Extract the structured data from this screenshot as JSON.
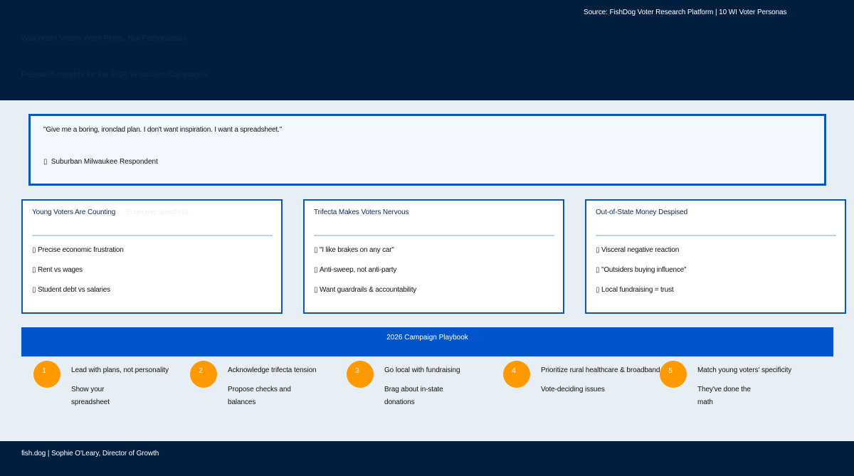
{
  "header": {
    "source": "Source: FishDog Voter Research Platform | 10 WI Voter Personas",
    "title": "Wisconsin Voters Want Plans, Not Personalities",
    "subtitle": "Research Insights for the 2026 Wisconsin Campaigns"
  },
  "quote": {
    "text": "\"Give me a boring, ironclad plan. I don't want inspiration. I want a spreadsheet.\"",
    "attribution_icon": "person-icon",
    "attribution": "Suburban Milwaukee Respondent"
  },
  "cards": [
    {
      "title": "Young Voters Are Counting",
      "subtitle": "Economic specificity",
      "items": [
        "Precise economic frustration",
        "Rent vs wages",
        "Student debt vs salaries"
      ]
    },
    {
      "title": "Trifecta Makes Voters Nervous",
      "items": [
        "\"I like brakes on any car\"",
        "Anti-sweep, not anti-party",
        "Want guardrails & accountability"
      ]
    },
    {
      "title": "Out-of-State Money Despised",
      "items": [
        "Visceral negative reaction",
        "\"Outsiders buying influence\"",
        "Local fundraising = trust"
      ]
    }
  ],
  "playbook": {
    "title": "2026 Campaign Playbook",
    "steps": [
      {
        "num": "1",
        "title": "Lead with plans, not personality",
        "desc": "Show your spreadsheet"
      },
      {
        "num": "2",
        "title": "Acknowledge trifecta tension",
        "desc": "Propose checks and balances"
      },
      {
        "num": "3",
        "title": "Go local with fundraising",
        "desc": "Brag about in-state donations"
      },
      {
        "num": "4",
        "title": "Prioritize rural healthcare & broadband",
        "desc": "Vote-deciding issues"
      },
      {
        "num": "5",
        "title": "Match young voters' specificity",
        "desc": "They've done the math"
      }
    ]
  },
  "footer": {
    "text": "fish.dog | Sophie O'Leary, Director of Growth"
  },
  "colors": {
    "navy": "#001f3f",
    "accent_blue": "#0055cc",
    "card_border": "#0a57b8",
    "orange": "#ff9900",
    "background": "#e7eef6"
  }
}
